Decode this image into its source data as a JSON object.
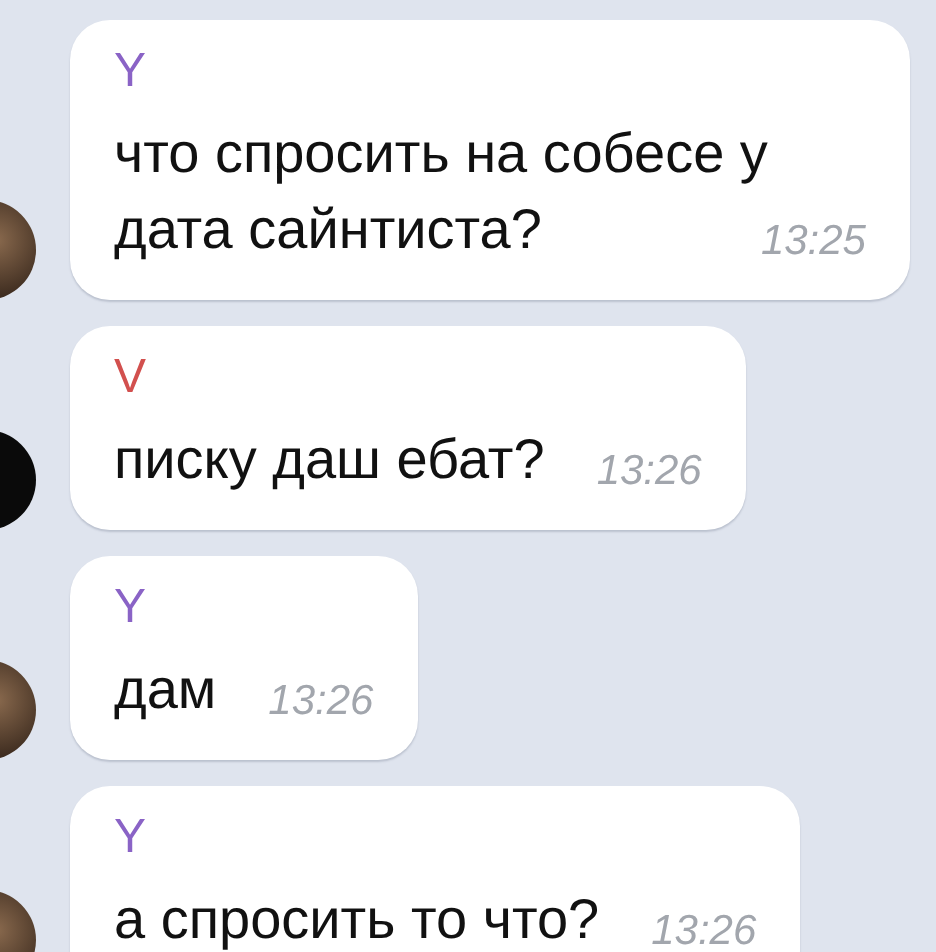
{
  "messages": [
    {
      "sender": "Y",
      "color": "#8a63c6",
      "text": "что спросить на собесе у дата сайнтиста?",
      "time": "13:25"
    },
    {
      "sender": "V",
      "color": "#d2504e",
      "text": "писку даш ебат?",
      "time": "13:26"
    },
    {
      "sender": "Y",
      "color": "#8a63c6",
      "text": "дам",
      "time": "13:26"
    },
    {
      "sender": "Y",
      "color": "#8a63c6",
      "text": "а спросить то что?",
      "time": "13:26"
    }
  ]
}
